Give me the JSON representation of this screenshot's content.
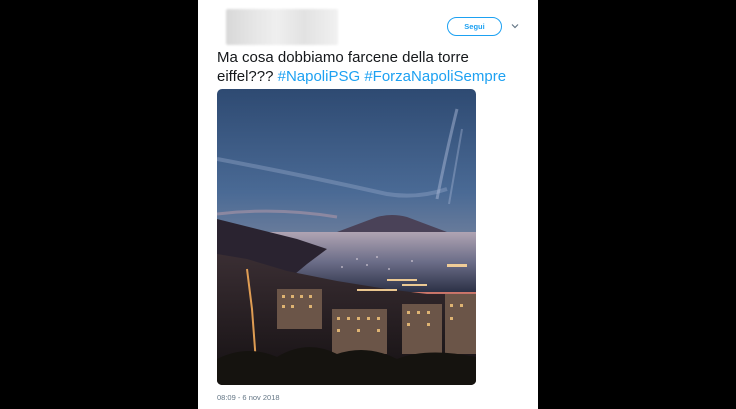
{
  "tweet": {
    "follow_label": "Segui",
    "text_main": "Ma cosa dobbiamo farcene della torre eiffel??? ",
    "hashtags": [
      "#NapoliPSG",
      "#ForzaNapoliSempre"
    ],
    "timestamp": "08:09 - 6 nov 2018",
    "photo_icon": "naples-bay-at-dusk-photo",
    "menu_icon": "chevron-down-icon"
  },
  "colors": {
    "accent": "#1da1f2",
    "text": "#14171a",
    "muted": "#657786",
    "backdrop": "#000000"
  }
}
